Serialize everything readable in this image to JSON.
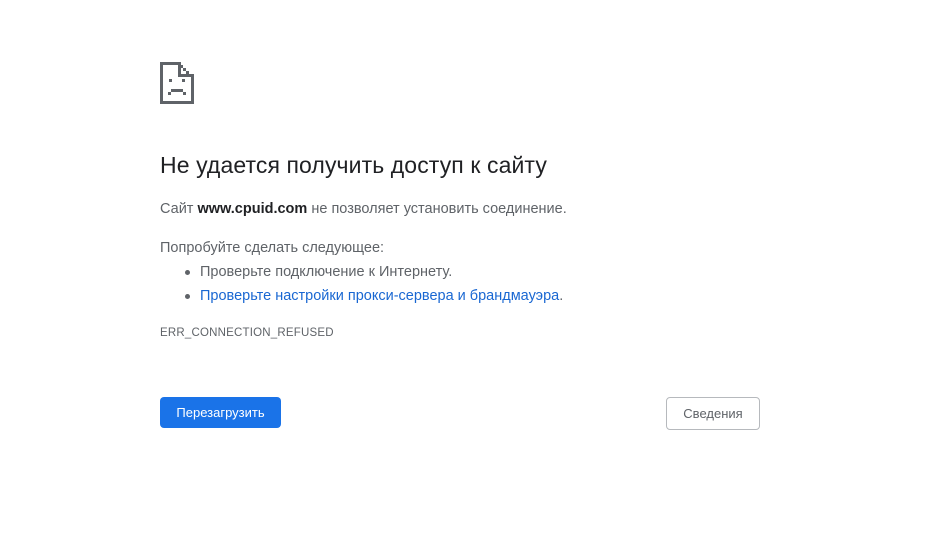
{
  "error_page": {
    "icon": "sad-page-icon",
    "title": "Не удается получить доступ к сайту",
    "summary_prefix": "Сайт ",
    "summary_host": "www.cpuid.com",
    "summary_suffix": " не позволяет установить соединение.",
    "suggestions_heading": "Попробуйте сделать следующее:",
    "suggestions": [
      {
        "text": "Проверьте подключение к Интернету."
      },
      {
        "link_text": "Проверьте настройки прокси-сервера и брандмауэра",
        "suffix": "."
      }
    ],
    "error_code": "ERR_CONNECTION_REFUSED",
    "reload_button": "Перезагрузить",
    "details_button": "Сведения"
  },
  "colors": {
    "primary_button": "#1a73e8",
    "link": "#1967d2",
    "text_primary": "#202124",
    "text_secondary": "#5f6368"
  }
}
